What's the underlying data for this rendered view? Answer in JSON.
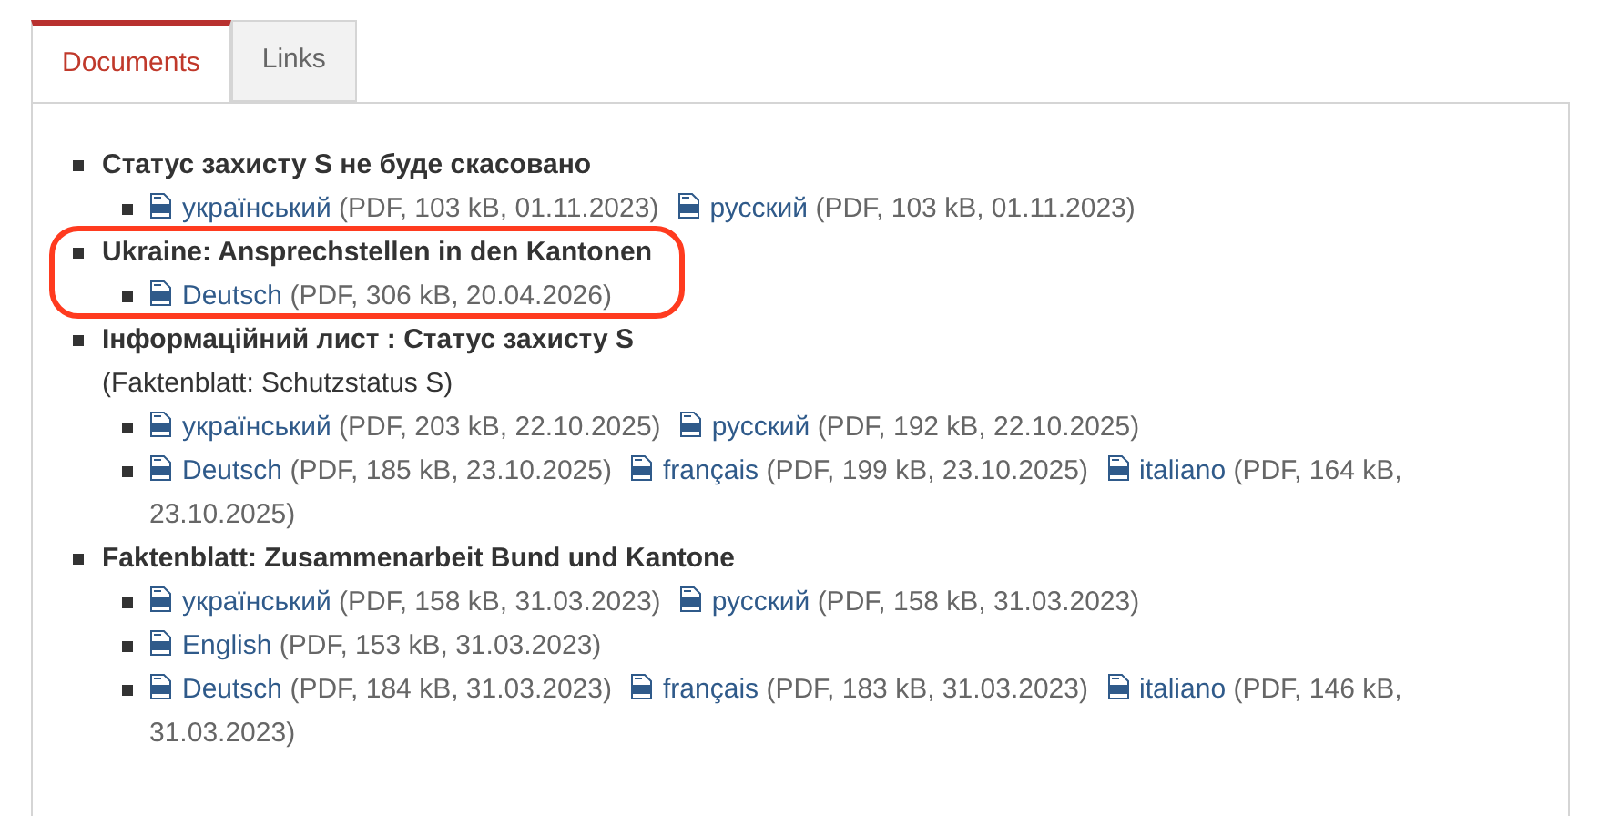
{
  "tabs": [
    {
      "label": "Documents",
      "selected": true
    },
    {
      "label": "Links",
      "selected": false
    }
  ],
  "groups": [
    {
      "title": "Статус захисту S не буде скасовано",
      "highlighted": false,
      "rows": [
        [
          {
            "link": "український",
            "meta": "(PDF, 103 kB, 01.11.2023)"
          },
          {
            "link": "русский",
            "meta": "(PDF, 103 kB, 01.11.2023)"
          }
        ]
      ]
    },
    {
      "title": "Ukraine: Ansprechstellen in den Kantonen",
      "highlighted": true,
      "rows": [
        [
          {
            "link": "Deutsch",
            "meta": "(PDF, 306 kB, 20.04.2026)"
          }
        ]
      ]
    },
    {
      "title": "Інформаційний лист : Статус захисту S",
      "subtitle": "(Faktenblatt: Schutzstatus S)",
      "highlighted": false,
      "rows": [
        [
          {
            "link": "український",
            "meta": "(PDF, 203 kB, 22.10.2025)"
          },
          {
            "link": "русский",
            "meta": "(PDF, 192 kB, 22.10.2025)"
          }
        ],
        [
          {
            "link": "Deutsch",
            "meta": "(PDF, 185 kB, 23.10.2025)"
          },
          {
            "link": "français",
            "meta": "(PDF, 199 kB, 23.10.2025)"
          },
          {
            "link": "italiano",
            "meta": "(PDF, 164 kB, 23.10.2025)"
          }
        ]
      ]
    },
    {
      "title": "Faktenblatt: Zusammenarbeit Bund und Kantone",
      "highlighted": false,
      "rows": [
        [
          {
            "link": "український",
            "meta": "(PDF, 158 kB, 31.03.2023)"
          },
          {
            "link": "русский",
            "meta": "(PDF, 158 kB, 31.03.2023)"
          }
        ],
        [
          {
            "link": "English",
            "meta": "(PDF, 153 kB, 31.03.2023)"
          }
        ],
        [
          {
            "link": "Deutsch",
            "meta": "(PDF, 184 kB, 31.03.2023)"
          },
          {
            "link": "français",
            "meta": "(PDF, 183 kB, 31.03.2023)"
          },
          {
            "link": "italiano",
            "meta": "(PDF, 146 kB, 31.03.2023)"
          }
        ]
      ]
    }
  ]
}
